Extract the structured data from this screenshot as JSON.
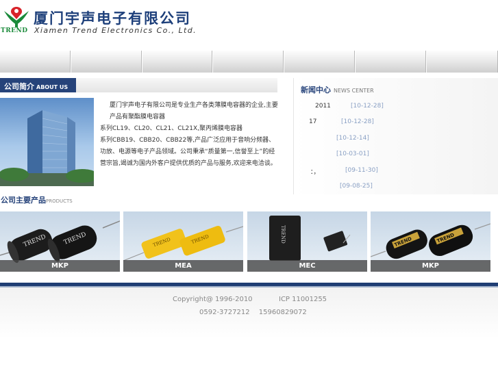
{
  "header": {
    "logo_text": "TREND",
    "company_cn": "厦门宇声电子有限公司",
    "company_en": "Xiamen Trend Electronics Co., Ltd."
  },
  "nav": {
    "items": [
      "",
      "",
      "",
      "",
      "",
      "",
      ""
    ]
  },
  "about": {
    "title_cn": "公司简介",
    "title_en": "ABOUT US",
    "text_line1": "厦门宇声电子有限公司是专业生产各类薄膜电容器的企业,主要产品有聚酯膜电容器",
    "text_line2": "系列CL19、CL20、CL21、CL21X,聚丙烯膜电容器",
    "text_line3": "系列CBB19、CBB20、CBB22等,产品广泛应用于音响分频器、功放、电源等电子产品领域。公司秉承“质量第一,信誉至上”的经营宗旨,竭诚为国内外客户提供优质的产品与服务,欢迎来电洽谈。"
  },
  "news": {
    "title_cn": "新闻中心",
    "title_en": "NEWS CENTER",
    "items": [
      {
        "text": "2011",
        "date": "[10-12-28]"
      },
      {
        "text": "17",
        "date": "[10-12-28]"
      },
      {
        "text": "",
        "date": "[10-12-14]"
      },
      {
        "text": "",
        "date": "[10-03-01]"
      },
      {
        "text": "：，",
        "date": "[09-11-30]"
      },
      {
        "text": "",
        "date": "[09-08-25]"
      }
    ]
  },
  "products": {
    "title_cn": "公司主要产品",
    "title_en": "PRODUCTS",
    "items": [
      {
        "label": "MKP",
        "print": "TREND"
      },
      {
        "label": "MEA",
        "print": "TREND"
      },
      {
        "label": "MEC",
        "print": "TREND"
      },
      {
        "label": "MKP",
        "print": "TREND"
      }
    ]
  },
  "footer": {
    "copyright": "Copyright@ 1996-2010",
    "icp": "ICP 11001255",
    "phone1": "0592-3727212",
    "phone2": "15960829072"
  }
}
